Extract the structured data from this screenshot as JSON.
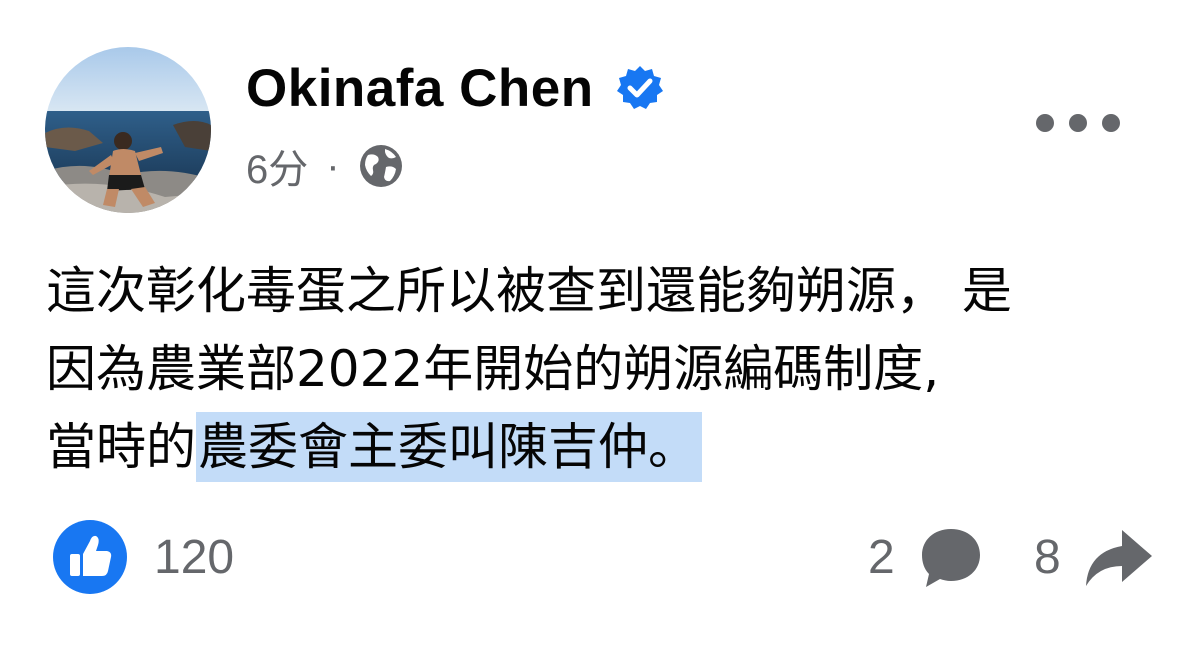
{
  "author": {
    "name": "Okinafa Chen",
    "verified": true
  },
  "meta": {
    "time": "6分",
    "separator": "·",
    "audience_icon": "globe-icon"
  },
  "post": {
    "lines": [
      "這次彰化毒蛋之所以被查到還能夠朔源， 是",
      "因為農業部2022年開始的朔源編碼制度,"
    ],
    "line3_prefix": "當時的",
    "line3_highlight": "農委會主委叫陳吉仲。"
  },
  "stats": {
    "likes": "120",
    "comments": "2",
    "shares": "8"
  },
  "icons": {
    "like": "like-icon",
    "comment": "comment-icon",
    "share": "share-icon",
    "more": "more-icon",
    "verified": "verified-badge-icon"
  },
  "colors": {
    "brand_blue": "#1877f2",
    "secondary_text": "#65676b",
    "highlight": "#c3dcf8"
  }
}
